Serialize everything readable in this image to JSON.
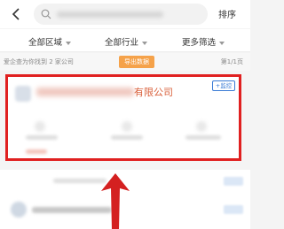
{
  "topbar": {
    "back_icon": "back-arrow-icon",
    "search_icon": "search-icon",
    "sort_label": "排序"
  },
  "filters": {
    "region": "全部区域",
    "industry": "全部行业",
    "more": "更多筛选"
  },
  "info": {
    "result_text": "爱企查为你找到 2 家公司",
    "export_label": "导出数据",
    "page_text": "第1/1页"
  },
  "card": {
    "company_name_suffix": "有限公司",
    "follow_label": "+监控"
  },
  "colors": {
    "highlight_border": "#e02020",
    "export_button": "#f5a24a",
    "company_name": "#d9603b",
    "follow": "#3a7bd5",
    "arrow": "#d42020"
  }
}
